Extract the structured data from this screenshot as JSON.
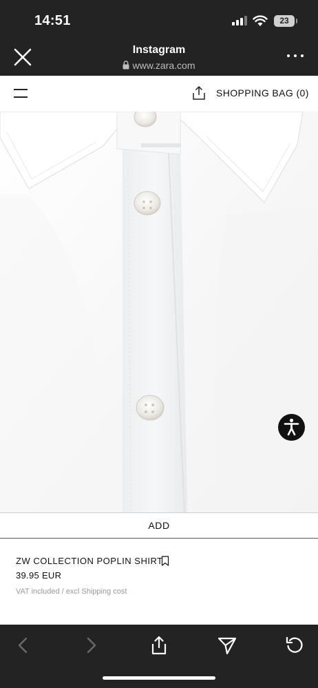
{
  "status_bar": {
    "time": "14:51",
    "battery": "23",
    "icons": [
      "signal-icon",
      "wifi-icon",
      "battery-icon"
    ]
  },
  "browser": {
    "title": "Instagram",
    "url": "www.zara.com",
    "icons": [
      "close-icon",
      "lock-icon",
      "more-icon"
    ]
  },
  "site_header": {
    "bag_label": "SHOPPING BAG (0)",
    "icons": [
      "menu-icon",
      "share-icon"
    ]
  },
  "product": {
    "add_label": "ADD",
    "name": "ZW COLLECTION POPLIN SHIRT",
    "price": "39.95 EUR",
    "vat_note": "VAT included / excl Shipping cost",
    "image_subject": "white poplin shirt close-up",
    "icons": [
      "bookmark-icon",
      "accessibility-icon"
    ]
  },
  "toolbar": {
    "icons": [
      "back-icon",
      "forward-icon",
      "share-icon",
      "send-icon",
      "reload-icon"
    ]
  },
  "colors": {
    "chrome_bg": "#232323",
    "page_bg": "#ffffff",
    "text": "#111111",
    "muted_text": "#9a9a9a"
  }
}
